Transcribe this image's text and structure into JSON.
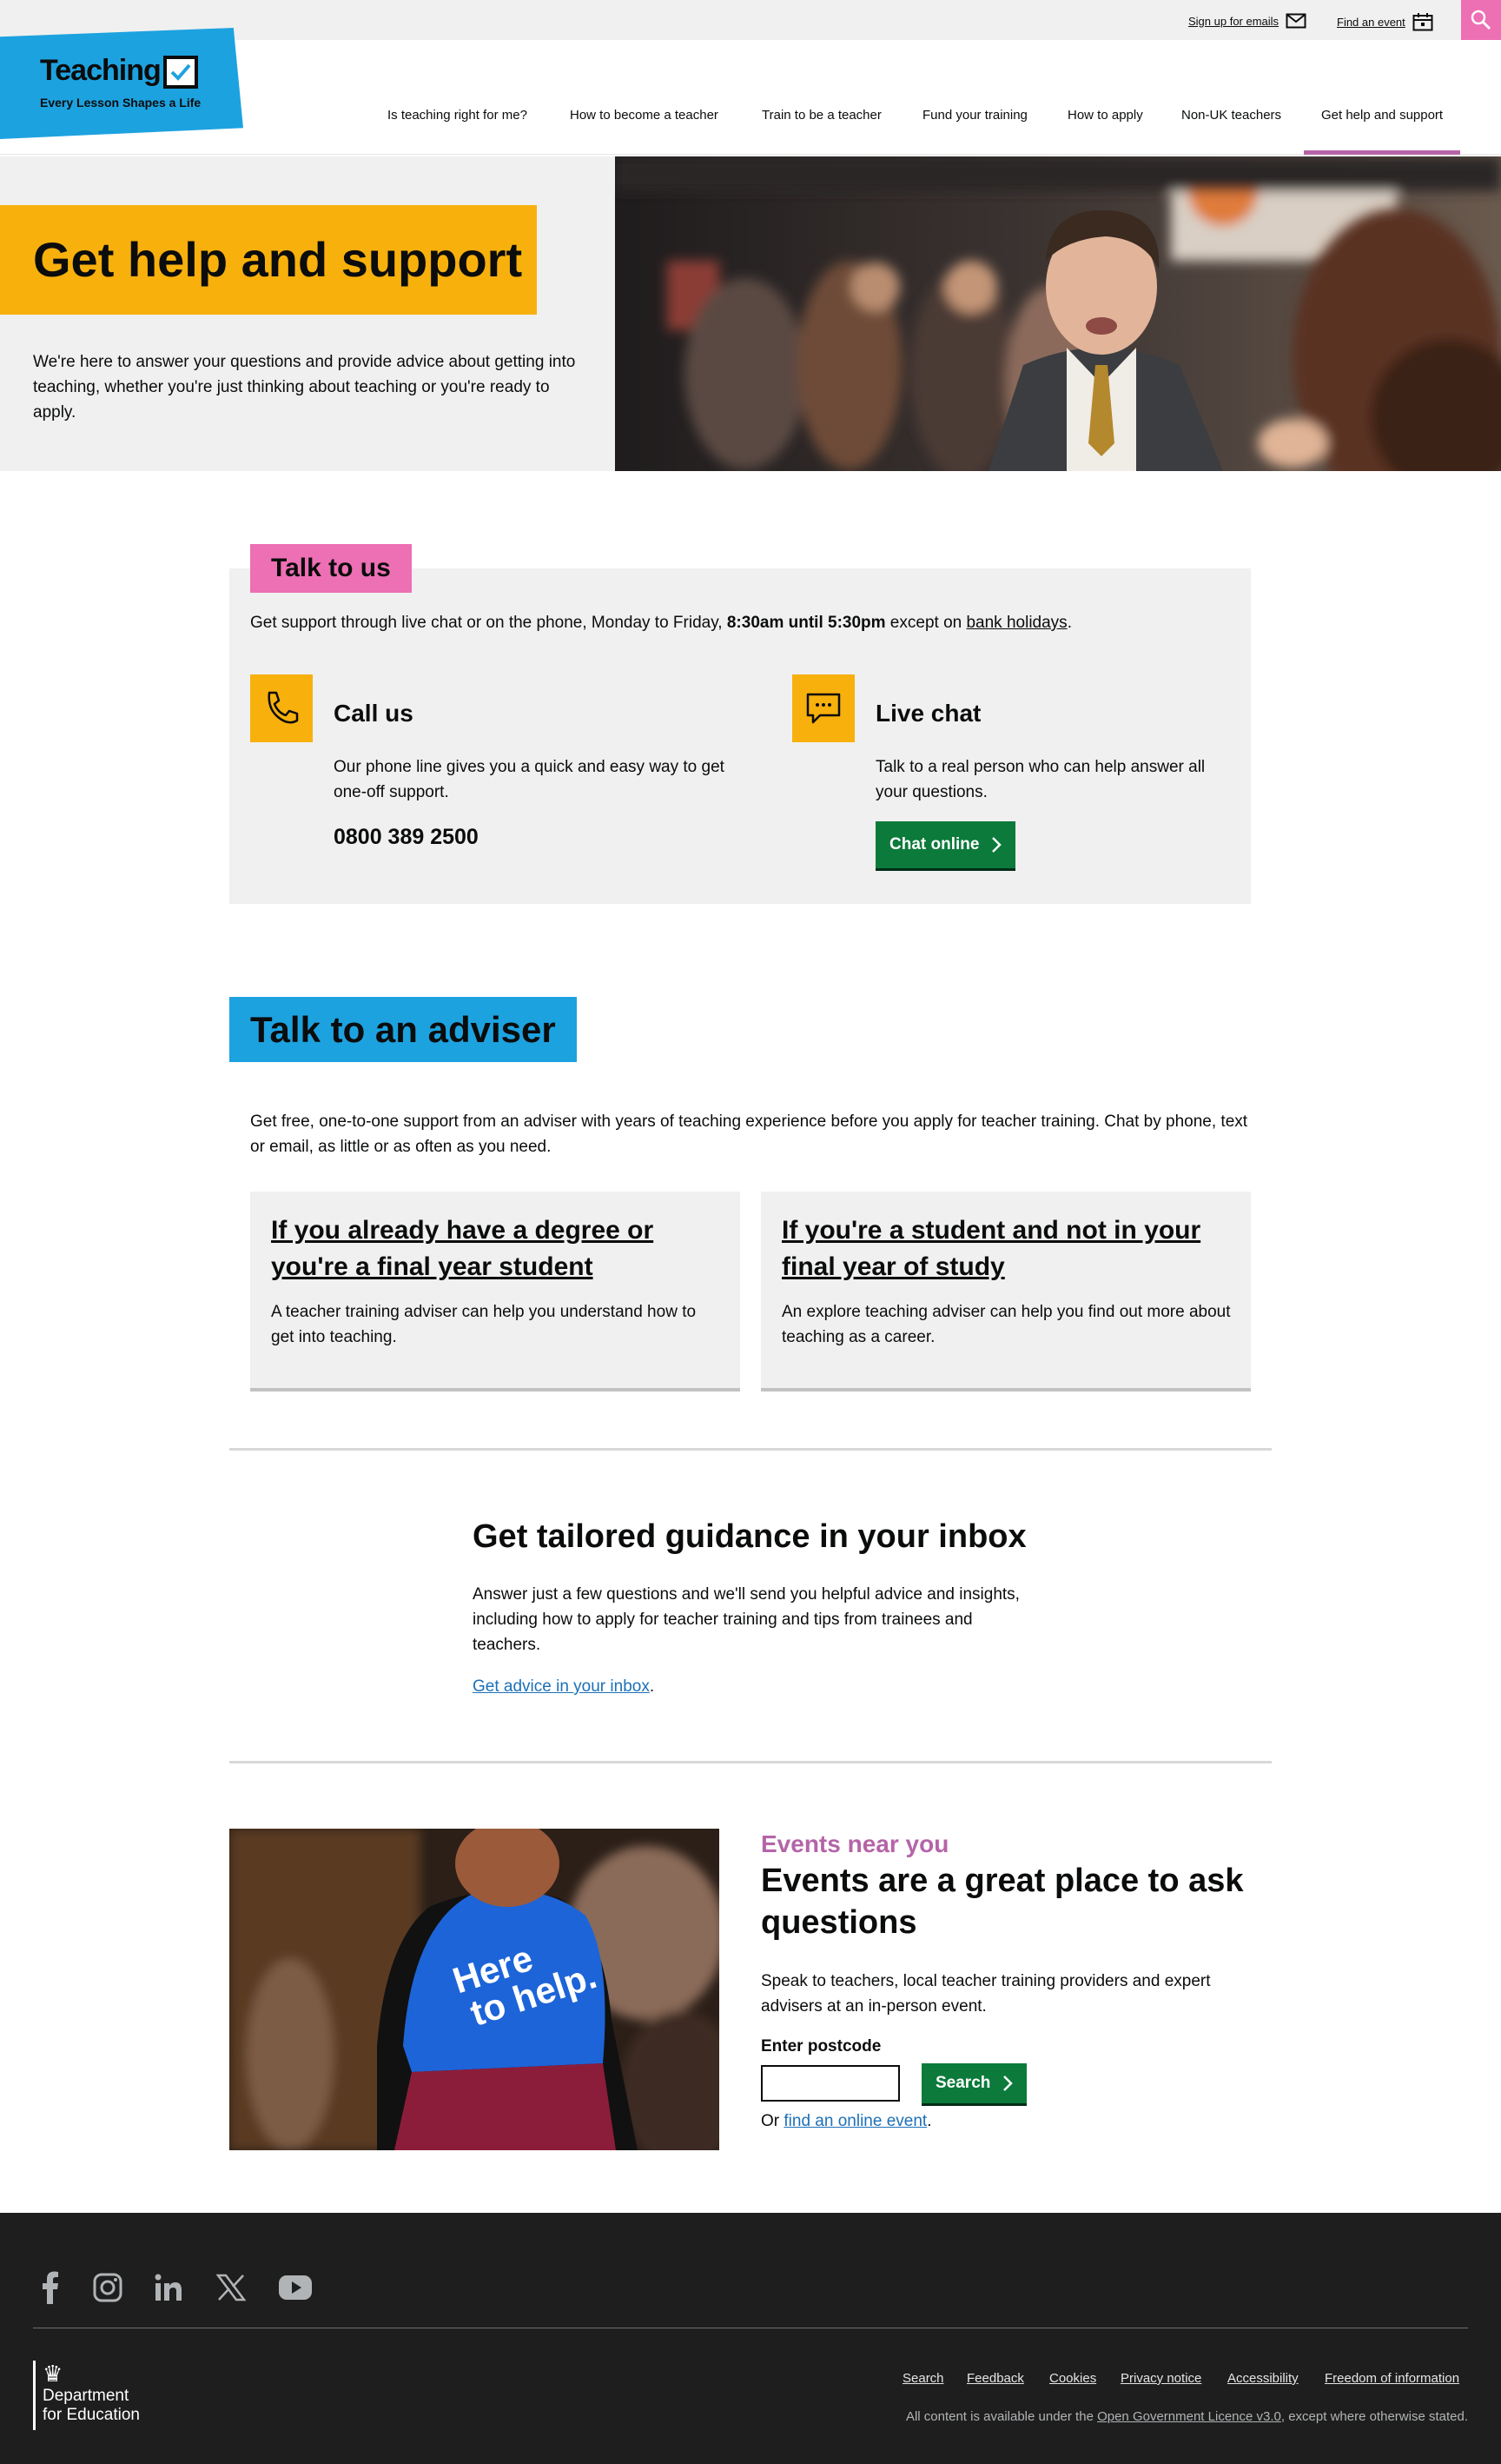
{
  "topbar": {
    "signup_label": "Sign up for emails",
    "event_label": "Find an event"
  },
  "logo": {
    "word": "Teaching",
    "tagline": "Every Lesson Shapes a Life"
  },
  "nav": {
    "items": [
      {
        "label": "Is teaching right for me?"
      },
      {
        "label": "How to become a teacher"
      },
      {
        "label": "Train to be a teacher"
      },
      {
        "label": "Fund your training"
      },
      {
        "label": "How to apply"
      },
      {
        "label": "Non-UK teachers"
      },
      {
        "label": "Get help and support"
      }
    ],
    "active_index": 6
  },
  "hero": {
    "title": "Get help and support",
    "text": "We're here to answer your questions and provide advice about getting into teaching, whether you're just thinking about teaching or you're ready to apply."
  },
  "talk": {
    "tag": "Talk to us",
    "intro_before": "Get support through live chat or on the phone, Monday to Friday, ",
    "intro_hours": "8:30am until 5:30pm",
    "intro_mid": " except on ",
    "intro_link": "bank holidays",
    "intro_after": ".",
    "call_title": "Call us",
    "call_text": "Our phone line gives you a quick and easy way to get one-off support.",
    "phone": "0800 389 2500",
    "chat_title": "Live chat",
    "chat_text": "Talk to a real person who can help answer all your questions.",
    "chat_button": "Chat online"
  },
  "adviser": {
    "tag": "Talk to an adviser",
    "intro": "Get free, one-to-one support from an adviser with years of teaching experience before you apply for teacher training. Chat by phone, text or email, as little or as often as you need.",
    "cards": [
      {
        "title": "If you already have a degree or you're a final year student",
        "text": "A teacher training adviser can help you understand how to get into teaching."
      },
      {
        "title": "If you're a student and not in your final year of study",
        "text": "An explore teaching adviser can help you find out more about teaching as a career."
      }
    ]
  },
  "guidance": {
    "title": "Get tailored guidance in your inbox",
    "text": "Answer just a few questions and we'll send you helpful advice and insights, including how to apply for teacher training and tips from trainees and teachers.",
    "link": "Get advice in your inbox",
    "link_after": "."
  },
  "events": {
    "kicker": "Events near you",
    "title": "Events are a great place to ask questions",
    "text": "Speak to teachers, local teacher training providers and expert advisers at an in-person event.",
    "postcode_label": "Enter postcode",
    "postcode_value": "",
    "search_button": "Search",
    "or_before": "Or ",
    "or_link": "find an online event",
    "or_after": ".",
    "shirt_line1": "Here",
    "shirt_line2": "to help."
  },
  "footer": {
    "social": [
      "facebook-icon",
      "instagram-icon",
      "linkedin-icon",
      "x-icon",
      "youtube-icon"
    ],
    "dfe_line1": "Department",
    "dfe_line2": "for Education",
    "links": [
      "Search",
      "Feedback",
      "Cookies",
      "Privacy notice",
      "Accessibility",
      "Freedom of information"
    ],
    "licence_before": "All content is available under the ",
    "licence_link": "Open Government Licence v3.0",
    "licence_after": ", except where otherwise stated."
  },
  "colors": {
    "yellow": "#f8b00d",
    "pink": "#ed6fb4",
    "blue": "#1da2e0",
    "green": "#0b7a3a",
    "purple": "#b564a8",
    "link": "#1d70b8",
    "footer": "#1e1e1e"
  }
}
